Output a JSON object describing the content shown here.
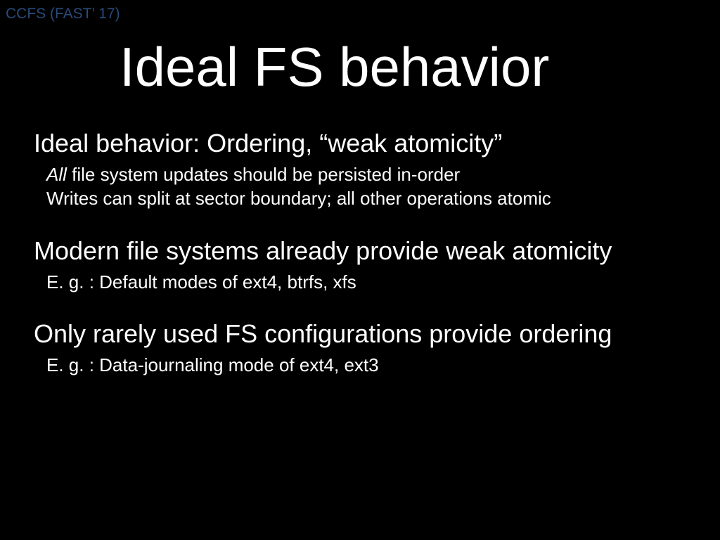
{
  "header": "CCFS (FAST’ 17)",
  "title": "Ideal FS behavior",
  "blocks": [
    {
      "heading": "Ideal behavior: Ordering, “weak atomicity”",
      "subs": [
        {
          "prefix_italic": "All",
          "rest": " file system updates should be persisted in-order"
        },
        {
          "prefix_italic": "",
          "rest": "Writes can split at sector boundary; all other operations atomic"
        }
      ]
    },
    {
      "heading": "Modern file systems already provide weak atomicity",
      "subs": [
        {
          "prefix_italic": "",
          "rest": "E. g. : Default modes of ext4, btrfs, xfs"
        }
      ]
    },
    {
      "heading": "Only rarely used FS configurations provide ordering",
      "subs": [
        {
          "prefix_italic": "",
          "rest": "E. g. : Data-journaling mode of ext4, ext3"
        }
      ]
    }
  ]
}
